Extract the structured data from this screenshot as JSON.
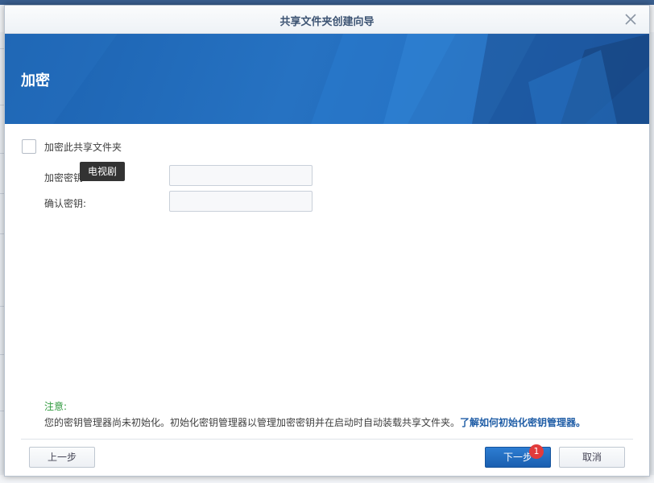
{
  "dialog": {
    "title": "共享文件夹创建向导",
    "close_icon": "close-icon"
  },
  "banner": {
    "heading": "加密"
  },
  "encryption": {
    "checkbox_label": "加密此共享文件夹",
    "checked": false,
    "key_label": "加密密钥:",
    "confirm_label": "确认密钥:",
    "key_value": "",
    "confirm_value": ""
  },
  "tooltip": {
    "text": "电视剧"
  },
  "note": {
    "title": "注意:",
    "text": "您的密钥管理器尚未初始化。初始化密钥管理器以管理加密密钥并在启动时自动装载共享文件夹。",
    "link": "了解如何初始化密钥管理器。"
  },
  "footer": {
    "prev_label": "上一步",
    "next_label": "下一步",
    "cancel_label": "取消",
    "badge_count": "1"
  },
  "colors": {
    "banner": "#2672c2",
    "primary_button": "#1a5fb0",
    "note_title": "#2f9a3e",
    "link": "#1f5da6",
    "badge": "#e23b3b"
  }
}
